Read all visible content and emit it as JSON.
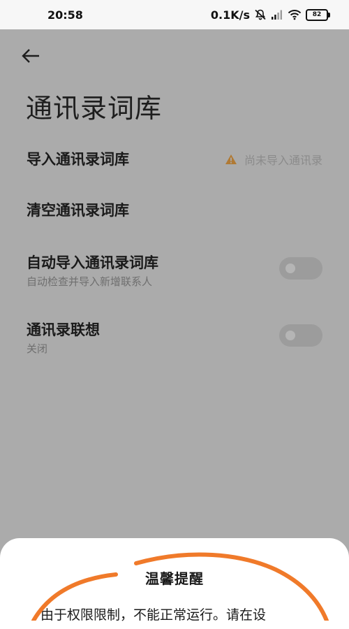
{
  "status_bar": {
    "time": "20:58",
    "network_speed": "0.1K/s",
    "battery": "82",
    "icons": [
      "mute-icon",
      "signal-icon",
      "wifi-icon",
      "battery-icon"
    ]
  },
  "header": {
    "back_icon": "arrow-left-icon",
    "title": "通讯录词库"
  },
  "settings": {
    "import": {
      "title": "导入通讯录词库",
      "status": "尚未导入通讯录",
      "status_icon": "warning-icon"
    },
    "clear": {
      "title": "清空通讯录词库"
    },
    "auto_import": {
      "title": "自动导入通讯录词库",
      "subtitle": "自动检查并导入新增联系人",
      "enabled": false
    },
    "association": {
      "title": "通讯录联想",
      "subtitle": "关闭",
      "enabled": false
    }
  },
  "dialog": {
    "title": "温馨提醒",
    "body": "由于权限限制，不能正常运行。请在设"
  },
  "colors": {
    "warning": "#c07a1f",
    "annotation": "#f07a2a",
    "overlay_bg": "#ababab"
  }
}
